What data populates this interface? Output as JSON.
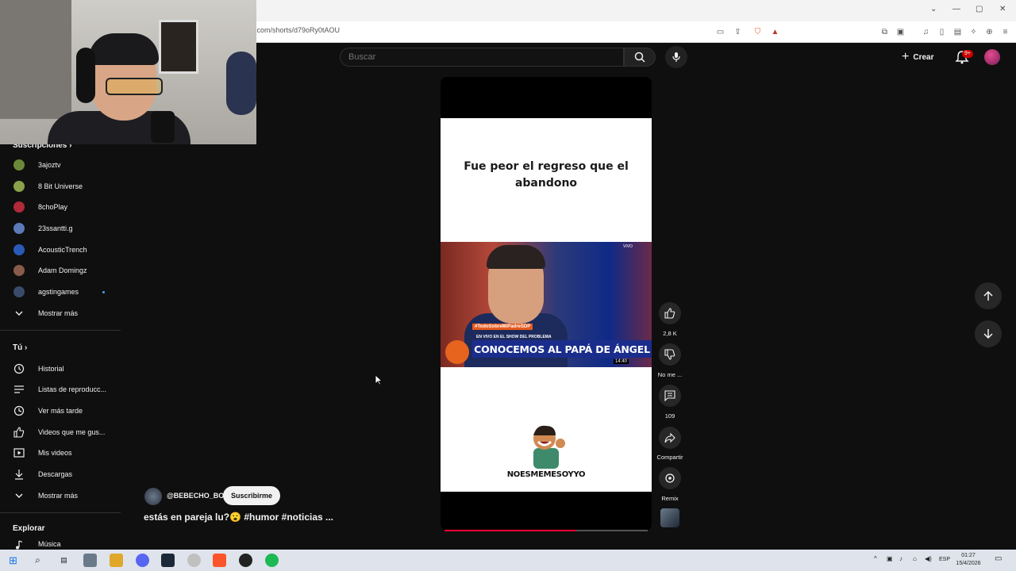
{
  "browser": {
    "url": "e.com/shorts/d79oRy0tAOU",
    "window_controls": [
      "⌄",
      "—",
      "▢",
      "✕"
    ]
  },
  "header": {
    "search_placeholder": "Buscar",
    "create_label": "Crear",
    "notifications_badge": "9+"
  },
  "sidebar": {
    "subscriptions_header": "Suscripciones",
    "subscriptions": [
      {
        "label": "3ajoztv",
        "color": "#6a8a3a"
      },
      {
        "label": "8 Bit Universe",
        "color": "#8aa04a"
      },
      {
        "label": "8choPlay",
        "color": "#b02a3a"
      },
      {
        "label": "23ssantti.g",
        "color": "#5a7ab8"
      },
      {
        "label": "AcousticTrench",
        "color": "#2a5ab8"
      },
      {
        "label": "Adam Domingz",
        "color": "#8a5a4a"
      },
      {
        "label": "agstingames",
        "color": "#3a4a6a"
      }
    ],
    "show_more_1": "Mostrar más",
    "you_header": "Tú",
    "you_items": [
      {
        "label": "Historial",
        "icon": "history-icon"
      },
      {
        "label": "Listas de reproducc...",
        "icon": "playlist-icon"
      },
      {
        "label": "Ver más tarde",
        "icon": "clock-icon"
      },
      {
        "label": "Videos que me gus...",
        "icon": "thumbs-up-icon"
      },
      {
        "label": "Mis videos",
        "icon": "video-icon"
      },
      {
        "label": "Descargas",
        "icon": "download-icon"
      }
    ],
    "show_more_2": "Mostrar más",
    "explore_header": "Explorar",
    "explore_items": [
      {
        "label": "Música",
        "icon": "music-icon"
      }
    ]
  },
  "short": {
    "caption": "Fue peor el regreso que el abandono",
    "clip_hashtag": "#TodoSobreMiPadreSDP",
    "clip_subtitle": "EN VIVO EN EL SHOW DEL PROBLEMA",
    "clip_banner": "CONOCEMOS AL PAPÁ DE ÁNGEL",
    "clip_time": "14:40",
    "clip_live": "VIVO",
    "meme_text": "NOESMEMESOYYO",
    "progress_fraction": 0.65,
    "channel": "@BEBECHO_BO",
    "subscribe_label": "Suscribirme",
    "title": "estás en pareja lu?😮 #humor #noticias ..."
  },
  "actions": {
    "likes": "2,8 K",
    "dislike_label": "No me ...",
    "comments": "109",
    "share_label": "Compartir",
    "remix_label": "Remix"
  },
  "taskbar": {
    "language": "ESP",
    "time": "01:27",
    "date": "15/4/2026"
  },
  "colors": {
    "background": "#0f0f0f",
    "accent_red": "#ff0033",
    "text_primary": "#f1f1f1"
  }
}
